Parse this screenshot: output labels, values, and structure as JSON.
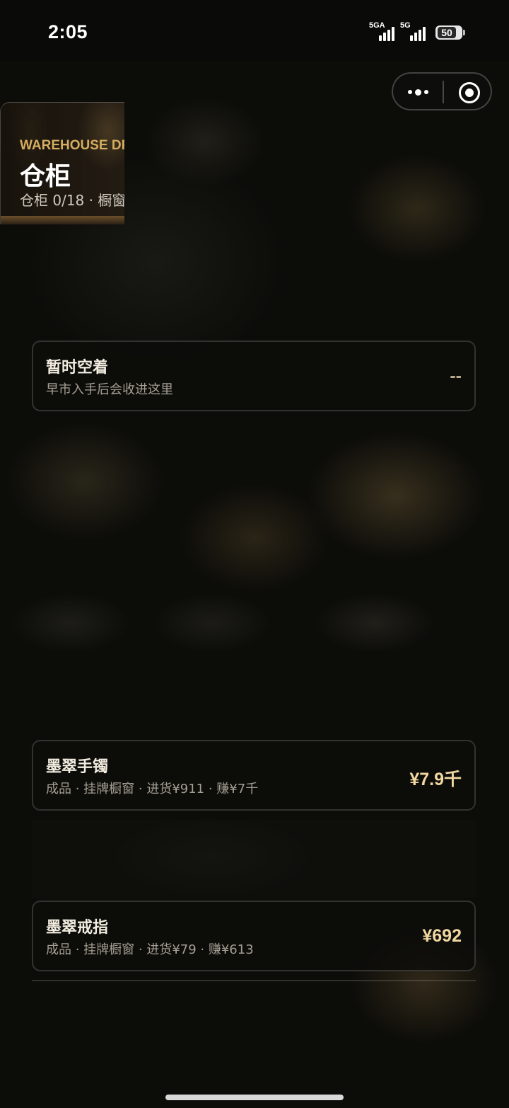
{
  "status_bar": {
    "time": "2:05",
    "signal1_label": "5GA",
    "signal2_label": "5G",
    "battery": "50"
  },
  "capsule": {
    "more_icon": "more-dots-icon",
    "close_icon": "target-close-icon"
  },
  "hero": {
    "eyebrow": "WAREHOUSE DR",
    "title": "仓柜",
    "subtitle": "仓柜 0/18 · 橱窗"
  },
  "slots": [
    {
      "name": "暂时空着",
      "meta": "早市入手后会收进这里",
      "price": "--"
    },
    {
      "name": "墨翠手镯",
      "meta": "成品 · 挂牌橱窗 · 进货¥911 · 赚¥7千",
      "price": "¥7.9千"
    },
    {
      "name": "墨翠戒指",
      "meta": "成品 · 挂牌橱窗 · 进货¥79 · 赚¥613",
      "price": "¥692"
    }
  ],
  "colors": {
    "accent_gold": "#d6ad5f",
    "price_gold": "#f1d7a0",
    "background": "#0c0c09"
  }
}
